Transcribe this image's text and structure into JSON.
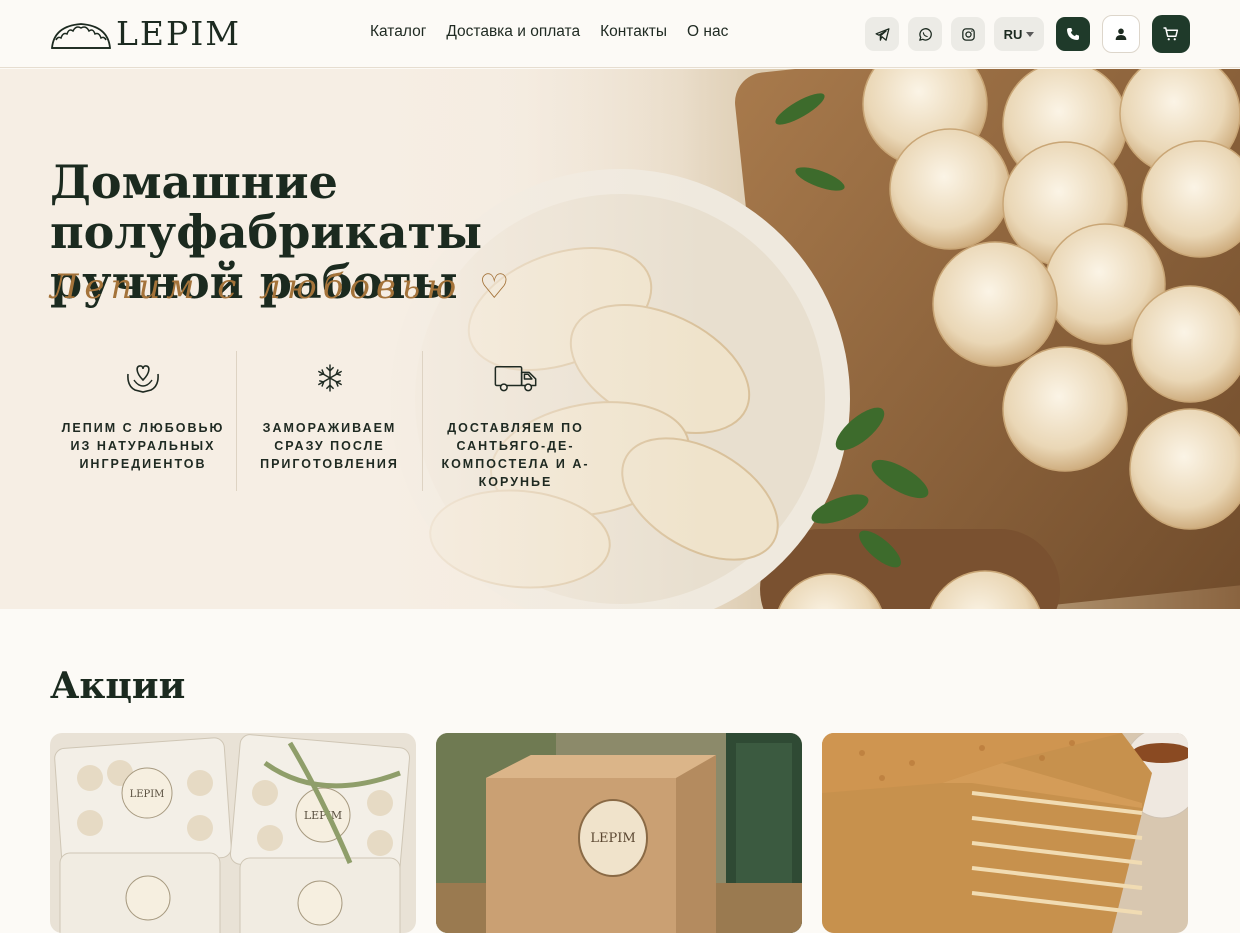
{
  "brand": {
    "name": "LEPIM"
  },
  "nav": {
    "items": [
      "Каталог",
      "Доставка и оплата",
      "Контакты",
      "О нас"
    ]
  },
  "header": {
    "language": "RU",
    "icons": [
      "telegram-icon",
      "whatsapp-icon",
      "instagram-icon",
      "phone-icon",
      "user-icon",
      "cart-icon"
    ]
  },
  "hero": {
    "title": "Домашние полуфабрикаты ручной работы",
    "slogan": "Лепим с любовью ♡",
    "features": [
      {
        "icon": "heart-hands-icon",
        "text": "Лепим с любовью из натуральных ингредиентов"
      },
      {
        "icon": "snowflake-icon",
        "text": "Замораживаем сразу после приготовления"
      },
      {
        "icon": "delivery-truck-icon",
        "text": "Доставляем по Сантьяго-де-Компостела и А-Корунье"
      }
    ]
  },
  "promotions": {
    "title": "Акции",
    "cards": [
      {
        "image": "frozen-dumpling-packs-photo",
        "label_text": "LEPIM"
      },
      {
        "image": "kraft-gift-box-photo",
        "label_text": "LEPIM"
      },
      {
        "image": "honey-cake-photo"
      }
    ]
  },
  "colors": {
    "accent": "#1f3a2a",
    "slogan": "#a4733a",
    "background": "#fcfaf6"
  }
}
